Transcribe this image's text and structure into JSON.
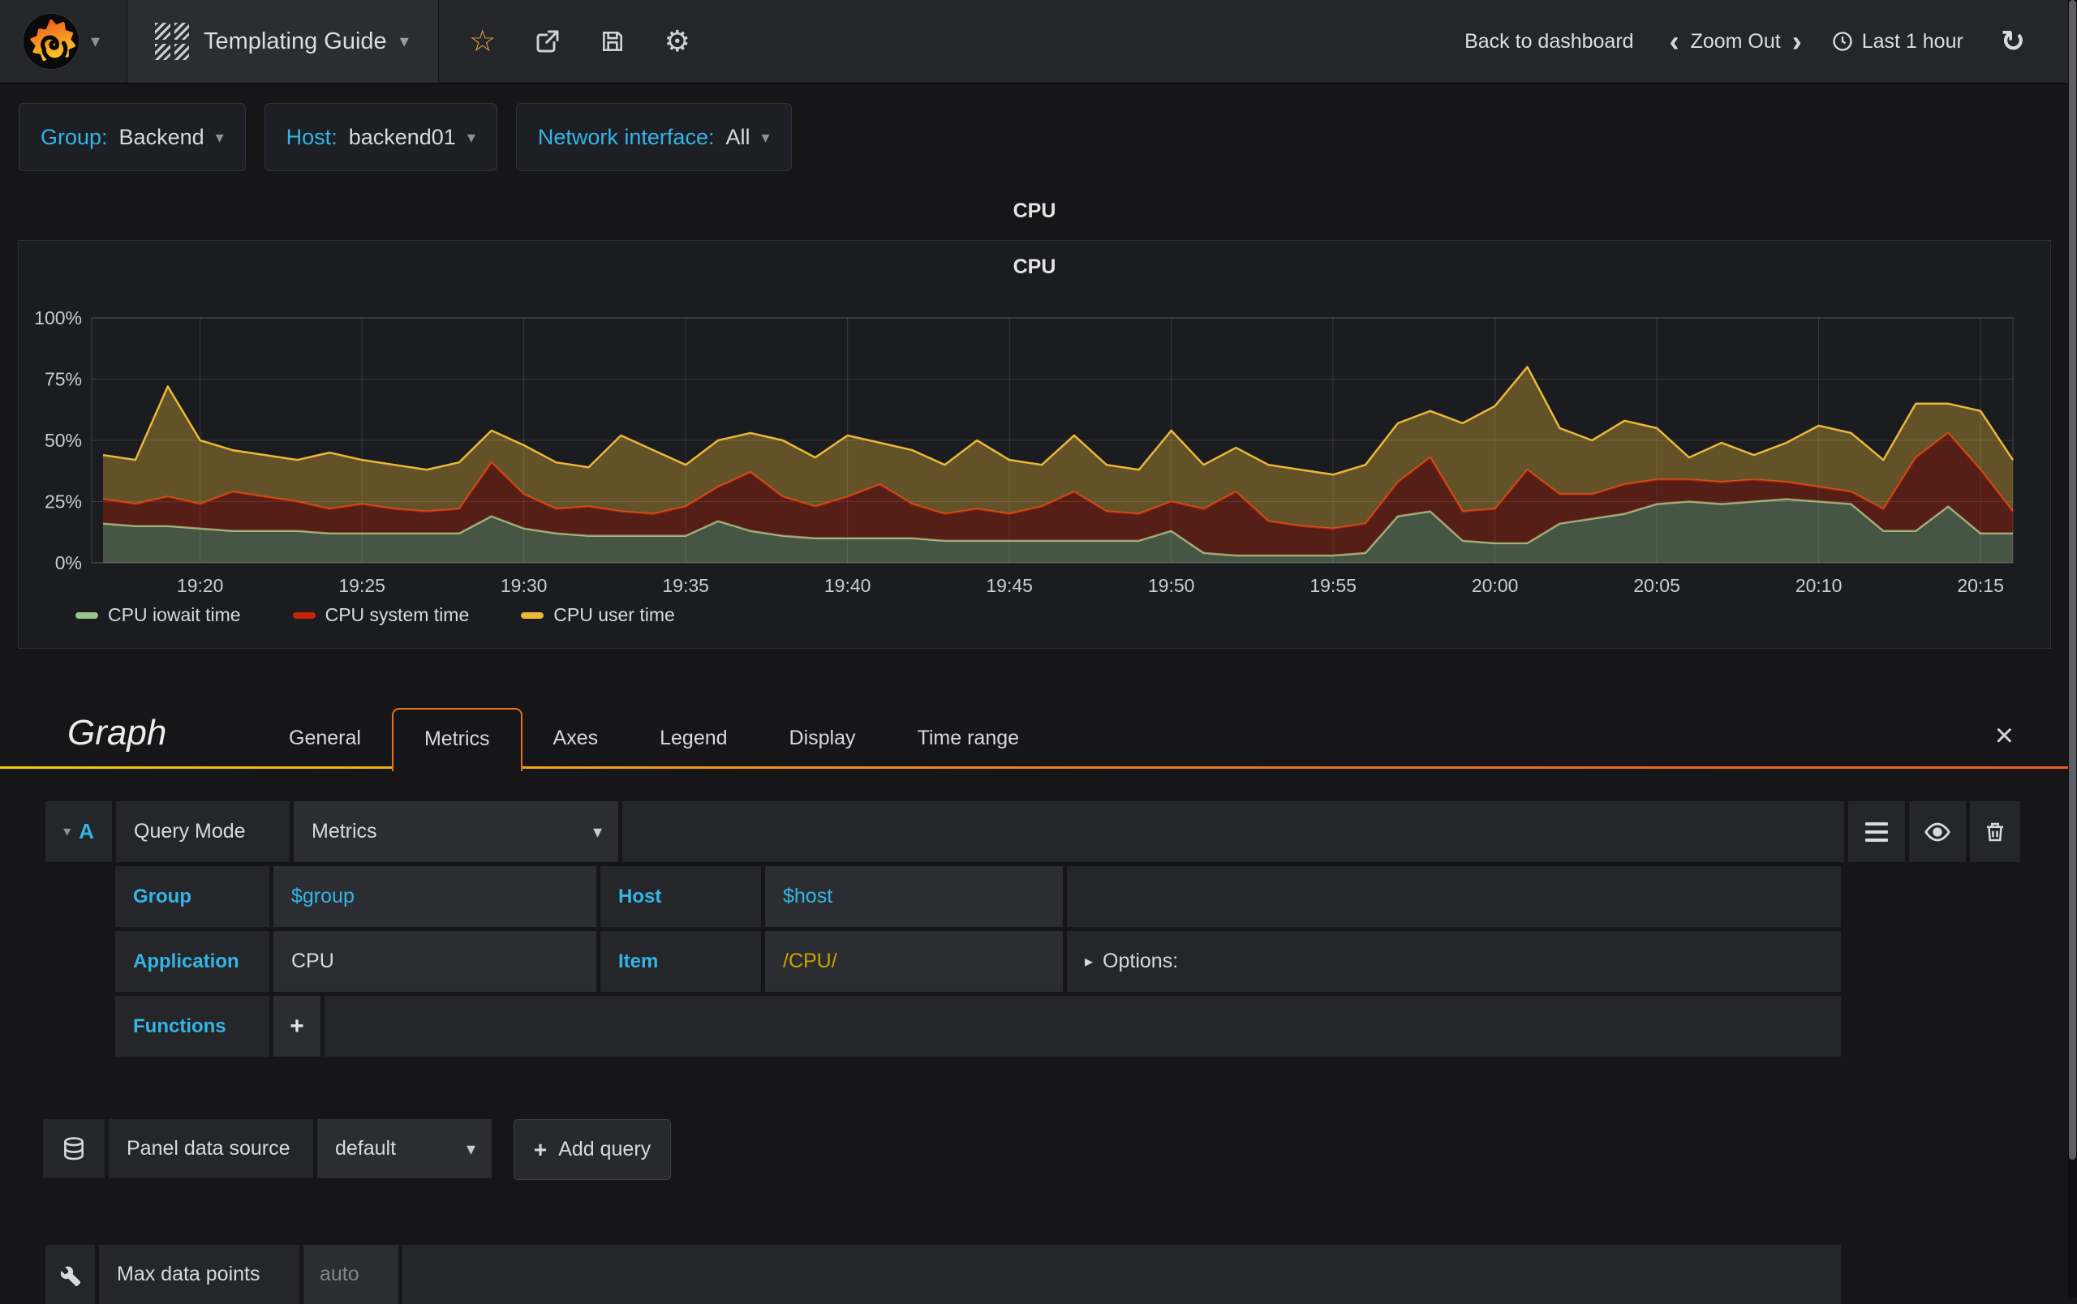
{
  "navbar": {
    "title": "Templating Guide",
    "back_label": "Back to dashboard",
    "zoom_out_label": "Zoom Out",
    "time_range": "Last 1 hour"
  },
  "icons": {
    "caret_down": "▾",
    "caret_right": "▸",
    "star": "☆",
    "gear": "⚙",
    "refresh": "↻",
    "chevron_left": "‹",
    "chevron_right": "›",
    "close": "×",
    "plus": "+"
  },
  "variables": [
    {
      "label": "Group:",
      "value": "Backend"
    },
    {
      "label": "Host:",
      "value": "backend01"
    },
    {
      "label": "Network interface:",
      "value": "All"
    }
  ],
  "panel": {
    "title": "CPU"
  },
  "chart_data": {
    "type": "area",
    "stacked": true,
    "title": "CPU",
    "x_start": "19:17",
    "x_step_minutes": 1,
    "x_tick_labels": [
      "19:20",
      "19:25",
      "19:30",
      "19:35",
      "19:40",
      "19:45",
      "19:50",
      "19:55",
      "20:00",
      "20:05",
      "20:10",
      "20:15"
    ],
    "y_tick_labels": [
      "0%",
      "25%",
      "50%",
      "75%",
      "100%"
    ],
    "y_tick_values": [
      0,
      25,
      50,
      75,
      100
    ],
    "ylim": [
      0,
      100
    ],
    "grid": true,
    "legend_position": "bottom-left",
    "series": [
      {
        "name": "CPU iowait time",
        "color": "#9ac48a",
        "values": [
          16,
          15,
          15,
          14,
          13,
          13,
          13,
          12,
          12,
          12,
          12,
          12,
          19,
          14,
          12,
          11,
          11,
          11,
          11,
          17,
          13,
          11,
          10,
          10,
          10,
          10,
          9,
          9,
          9,
          9,
          9,
          9,
          9,
          13,
          4,
          3,
          3,
          3,
          3,
          4,
          19,
          21,
          9,
          8,
          8,
          16,
          18,
          20,
          24,
          25,
          24,
          25,
          26,
          25,
          24,
          13,
          13,
          23,
          12,
          12
        ]
      },
      {
        "name": "CPU system time",
        "color": "#c2250a",
        "values": [
          10,
          9,
          12,
          10,
          16,
          14,
          12,
          10,
          12,
          10,
          9,
          10,
          22,
          14,
          10,
          12,
          10,
          9,
          12,
          14,
          24,
          16,
          13,
          17,
          22,
          14,
          11,
          13,
          11,
          14,
          20,
          12,
          11,
          12,
          18,
          26,
          14,
          12,
          11,
          12,
          14,
          22,
          12,
          14,
          30,
          12,
          10,
          12,
          10,
          9,
          9,
          9,
          7,
          6,
          5,
          9,
          30,
          30,
          26,
          9
        ]
      },
      {
        "name": "CPU user time",
        "color": "#eab839",
        "values": [
          18,
          18,
          45,
          26,
          17,
          17,
          17,
          23,
          18,
          18,
          17,
          19,
          13,
          20,
          19,
          16,
          31,
          26,
          17,
          19,
          16,
          23,
          20,
          25,
          17,
          22,
          20,
          28,
          22,
          17,
          23,
          19,
          18,
          29,
          18,
          18,
          23,
          23,
          22,
          24,
          24,
          19,
          36,
          42,
          42,
          27,
          22,
          26,
          21,
          9,
          16,
          10,
          16,
          25,
          24,
          20,
          22,
          12,
          24,
          21
        ]
      }
    ]
  },
  "editor": {
    "panel_type": "Graph",
    "tabs": [
      "General",
      "Metrics",
      "Axes",
      "Legend",
      "Display",
      "Time range"
    ],
    "active_tab": "Metrics",
    "query": {
      "ref": "A",
      "query_mode_label": "Query Mode",
      "query_mode_value": "Metrics",
      "group_label": "Group",
      "group_value": "$group",
      "host_label": "Host",
      "host_value": "$host",
      "application_label": "Application",
      "application_value": "CPU",
      "item_label": "Item",
      "item_value": "/CPU/",
      "options_label": "Options:",
      "functions_label": "Functions"
    },
    "datasource": {
      "label": "Panel data source",
      "value": "default",
      "add_label": "Add query"
    },
    "max_data_points": {
      "label": "Max data points",
      "placeholder": "auto"
    }
  },
  "colors": {
    "accent_blue": "#33b5e5",
    "value_yellow": "#cca300",
    "tab_border_orange": "#e8701a",
    "brand_gradient_start": "#f4cf00",
    "brand_gradient_end": "#f05a28"
  }
}
